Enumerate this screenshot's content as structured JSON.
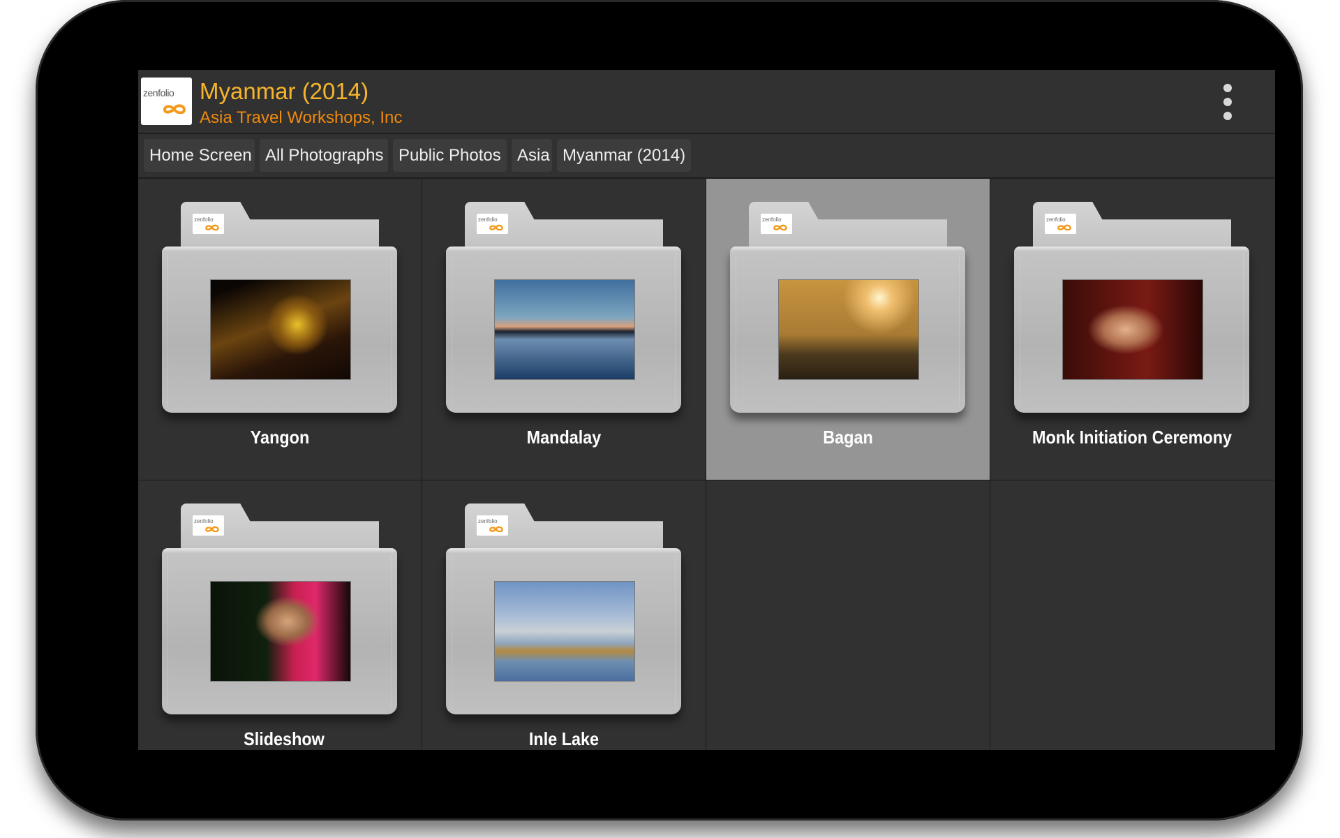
{
  "header": {
    "logo_text": "zenfolio",
    "title": "Myanmar (2014)",
    "subtitle": "Asia Travel Workshops, Inc",
    "menu_icon": "more-vert-icon"
  },
  "breadcrumbs": [
    {
      "label": "Home Screen"
    },
    {
      "label": "All Photographs"
    },
    {
      "label": "Public Photos"
    },
    {
      "label": "Asia"
    },
    {
      "label": "Myanmar (2014)"
    }
  ],
  "galleries": [
    {
      "label": "Yangon",
      "selected": false
    },
    {
      "label": "Mandalay",
      "selected": false
    },
    {
      "label": "Bagan",
      "selected": true
    },
    {
      "label": "Monk Initiation Ceremony",
      "selected": false
    },
    {
      "label": "Slideshow",
      "selected": false
    },
    {
      "label": "Inle Lake",
      "selected": false
    }
  ],
  "colors": {
    "title": "#f7b52c",
    "subtitle": "#f08a0c",
    "background": "#313131",
    "selected_cell": "#959595"
  }
}
